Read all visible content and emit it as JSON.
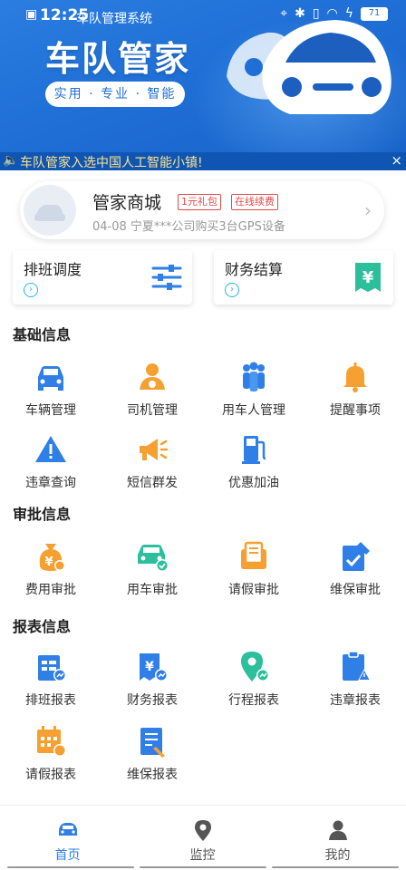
{
  "status_bar": {
    "time": "12:25",
    "app_label": "车队管理系统",
    "battery": "71"
  },
  "banner": {
    "title": "车队管家",
    "tagline": "实用 · 专业 · 智能"
  },
  "notice": {
    "text": "车队管家入选中国人工智能小镇!",
    "close": "×"
  },
  "shop": {
    "title": "管家商城",
    "tags": [
      "1元礼包",
      "在线续费"
    ],
    "subtitle": "04-08  宁夏***公司购买3台GPS设备"
  },
  "quick_actions": [
    {
      "label": "排班调度",
      "icon": "sliders-icon"
    },
    {
      "label": "财务结算",
      "icon": "yuan-receipt-icon"
    }
  ],
  "sections": [
    {
      "title": "基础信息",
      "items": [
        {
          "label": "车辆管理",
          "icon": "car-icon"
        },
        {
          "label": "司机管理",
          "icon": "driver-icon"
        },
        {
          "label": "用车人管理",
          "icon": "users-icon"
        },
        {
          "label": "提醒事项",
          "icon": "bell-icon"
        },
        {
          "label": "违章查询",
          "icon": "warning-icon"
        },
        {
          "label": "短信群发",
          "icon": "megaphone-icon"
        },
        {
          "label": "优惠加油",
          "icon": "fuel-pump-icon"
        }
      ]
    },
    {
      "title": "审批信息",
      "items": [
        {
          "label": "费用审批",
          "icon": "money-bag-icon"
        },
        {
          "label": "用车审批",
          "icon": "car-check-icon"
        },
        {
          "label": "请假审批",
          "icon": "leave-doc-icon"
        },
        {
          "label": "维保审批",
          "icon": "wrench-doc-icon"
        }
      ]
    },
    {
      "title": "报表信息",
      "items": [
        {
          "label": "排班报表",
          "icon": "schedule-report-icon"
        },
        {
          "label": "财务报表",
          "icon": "finance-report-icon"
        },
        {
          "label": "行程报表",
          "icon": "location-report-icon"
        },
        {
          "label": "违章报表",
          "icon": "violation-report-icon"
        },
        {
          "label": "请假报表",
          "icon": "calendar-report-icon"
        },
        {
          "label": "维保报表",
          "icon": "maintenance-report-icon"
        }
      ]
    }
  ],
  "tabs": [
    {
      "label": "首页",
      "icon": "home-car-icon",
      "active": true
    },
    {
      "label": "监控",
      "icon": "location-pin-icon",
      "active": false
    },
    {
      "label": "我的",
      "icon": "person-icon",
      "active": false
    }
  ],
  "colors": {
    "primary_blue": "#2f7fe6",
    "orange": "#f5a030",
    "teal": "#2bbf9b",
    "tag_red": "#e24a4a"
  }
}
